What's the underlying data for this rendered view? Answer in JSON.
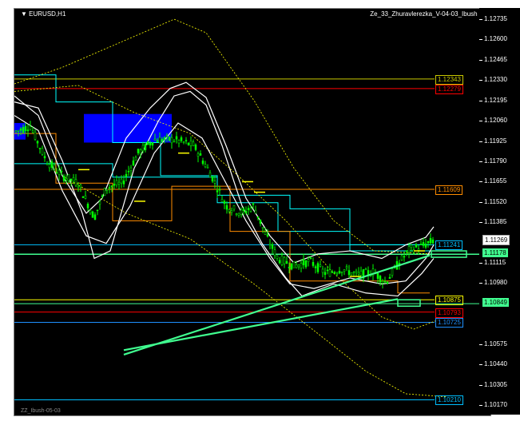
{
  "chart": {
    "symbol": "EURUSD,H1",
    "indicator_title": "Ze_33_Zhuravlerezka_V-04-03_Ibush",
    "bottom_indicator": "ZZ_Ibush-05-03"
  },
  "price_axis": {
    "labels": [
      "1.12735",
      "1.12600",
      "1.12465",
      "1.12330",
      "1.12195",
      "1.12060",
      "1.11925",
      "1.11790",
      "1.11655",
      "1.11520",
      "1.11385",
      "1.11115",
      "1.10980",
      "1.10575",
      "1.10440",
      "1.10305",
      "1.10170"
    ],
    "current_bid": "1.11269",
    "current_level": "1.11178",
    "level_marker": "1.10849"
  },
  "levels": [
    {
      "label": "1.12343",
      "color": "#c8c800"
    },
    {
      "label": "1.12279",
      "color": "#ff0000"
    },
    {
      "label": "1.11609",
      "color": "#ff8c00"
    },
    {
      "label": "1.11241",
      "color": "#00bfff"
    },
    {
      "label": "1.10875",
      "color": "#ffff00"
    },
    {
      "label": "1.10793",
      "color": "#ff0000"
    },
    {
      "label": "1.10725",
      "color": "#1e90ff"
    },
    {
      "label": "1.10210",
      "color": "#00bfff"
    }
  ],
  "colors": {
    "background": "#000000",
    "candles": "#00ff00",
    "bands": "#ffffff",
    "channel": "#00ffff",
    "trend_arrows": "#40ff90",
    "blue_zone": "#0000ff",
    "orange_steps": "#ff8c00",
    "dotted_envelope": "#ffff00"
  }
}
